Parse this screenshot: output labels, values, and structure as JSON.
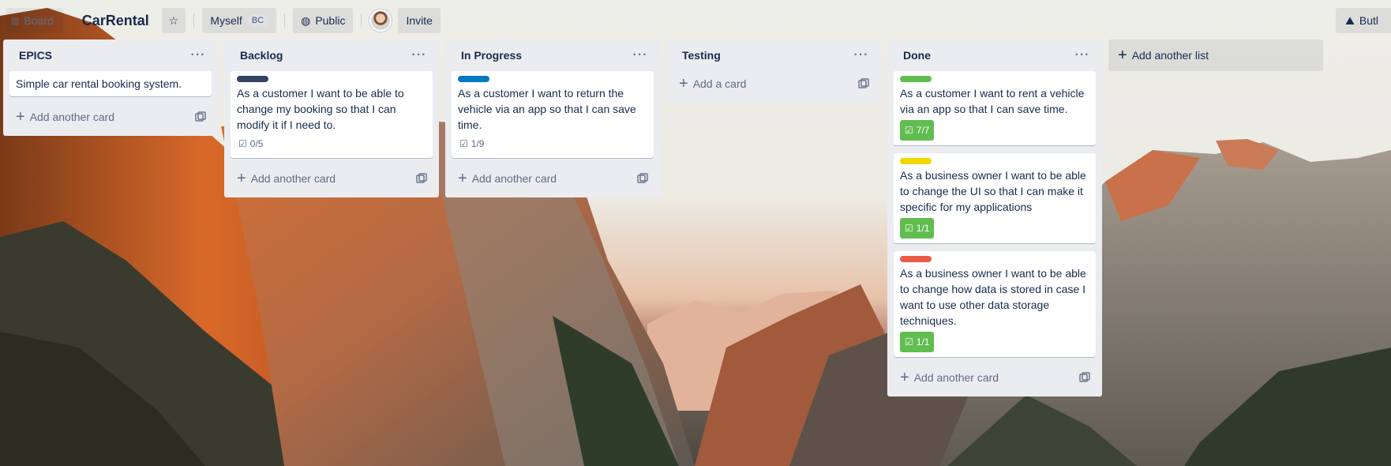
{
  "topbar": {
    "board_button": "Board",
    "board_title": "CarRental",
    "team": "Myself",
    "team_badge": "BC",
    "visibility": "Public",
    "invite": "Invite",
    "butler": "Butl"
  },
  "lists": [
    {
      "title": "EPICS",
      "cards": [
        {
          "text": "Simple car rental booking system."
        }
      ],
      "composer": "Add another card"
    },
    {
      "title": "Backlog",
      "cards": [
        {
          "label_color": "#344563",
          "text": "As a customer I want to be able to change my booking so that I can modify it if I need to.",
          "checklist": "0/5"
        }
      ],
      "composer": "Add another card"
    },
    {
      "title": "In Progress",
      "cards": [
        {
          "label_color": "#0079bf",
          "text": "As a customer I want to return the vehicle via an app so that I can save time.",
          "checklist": "1/9"
        }
      ],
      "composer": "Add another card"
    },
    {
      "title": "Testing",
      "cards": [],
      "composer": "Add a card"
    },
    {
      "title": "Done",
      "cards": [
        {
          "label_color": "#61bd4f",
          "text": "As a customer I want to rent a vehicle via an app so that I can save time.",
          "checklist": "7/7"
        },
        {
          "label_color": "#f2d600",
          "text": "As a business owner I want to be able to change the UI so that I can make it specific for my applications",
          "checklist": "1/1"
        },
        {
          "label_color": "#eb5a46",
          "text": "As a business owner I want to be able to change how data is stored in case I want to use other data storage techniques.",
          "checklist": "1/1"
        }
      ],
      "composer": "Add another card"
    }
  ],
  "add_list": "Add another list",
  "colors": {
    "list_bg": "#ebecf0",
    "complete_badge": "#61bd4f"
  }
}
